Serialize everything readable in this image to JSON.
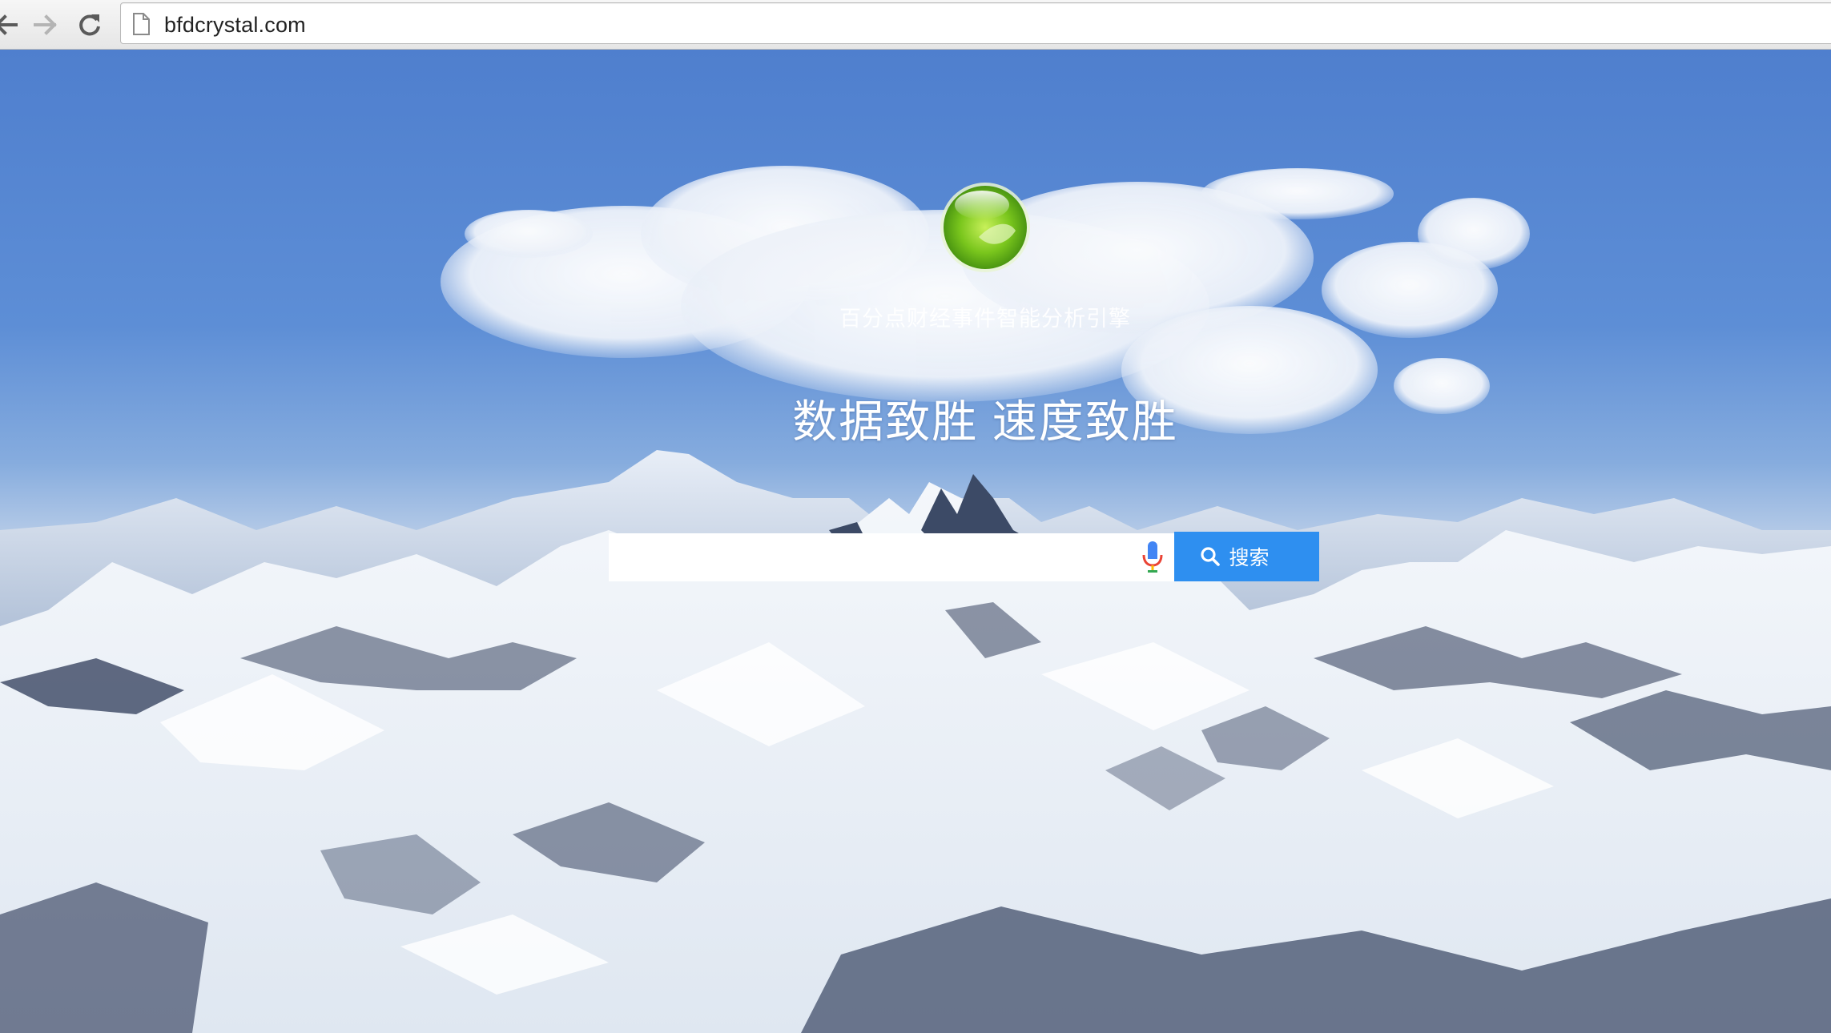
{
  "browser": {
    "url": "bfdcrystal.com",
    "icons": {
      "back": "back-arrow-icon",
      "forward": "forward-arrow-icon",
      "reload": "reload-icon",
      "page": "page-icon"
    }
  },
  "page": {
    "logo": "green-sphere-logo",
    "tagline": "百分点财经事件智能分析引擎",
    "slogan": "数据致胜 速度致胜",
    "search": {
      "input_value": "",
      "placeholder": "",
      "mic_icon": "microphone-icon",
      "button_icon": "search-icon",
      "button_label": "搜索"
    }
  },
  "colors": {
    "sky": "#5d8ed6",
    "search_button": "#2e8ff0",
    "logo_green": "#7ac61d"
  }
}
